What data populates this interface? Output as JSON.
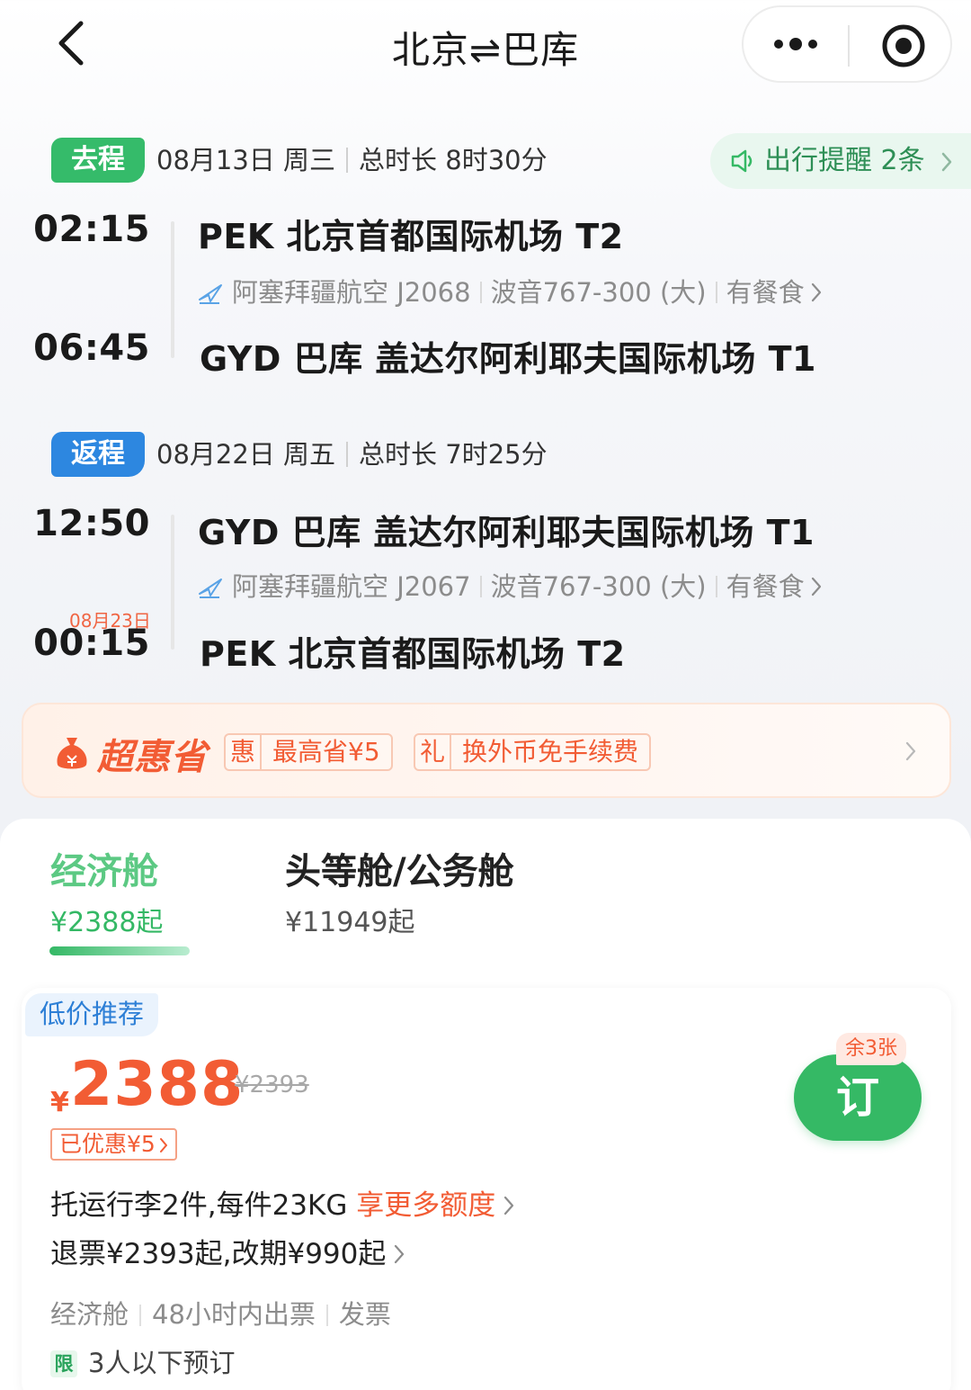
{
  "nav": {
    "title_from": "北京",
    "title_arrow": "⇌",
    "title_to": "巴库",
    "back_icon": "chevron-left-icon",
    "more_icon": "more-dots-icon",
    "target_icon": "close-target-icon"
  },
  "outbound": {
    "tag": "去程",
    "date": "08月13日 周三",
    "duration": "总时长 8时30分",
    "reminder": "出行提醒 2条",
    "dep_time": "02:15",
    "dep_airport": "PEK 北京首都国际机场 T2",
    "airline": "阿塞拜疆航空 J2068",
    "aircraft": "波音767-300 (大)",
    "meal": "有餐食",
    "arr_time": "06:45",
    "arr_airport": "GYD 巴库 盖达尔阿利耶夫国际机场 T1"
  },
  "return": {
    "tag": "返程",
    "date": "08月22日 周五",
    "duration": "总时长 7时25分",
    "dep_time": "12:50",
    "dep_airport": "GYD 巴库 盖达尔阿利耶夫国际机场 T1",
    "airline": "阿塞拜疆航空 J2067",
    "aircraft": "波音767-300 (大)",
    "meal": "有餐食",
    "arr_date": "08月23日",
    "arr_time": "00:15",
    "arr_airport": "PEK 北京首都国际机场 T2"
  },
  "promo": {
    "brand": "超惠省",
    "chip1_key": "惠",
    "chip1_val": "最高省¥5",
    "chip2_key": "礼",
    "chip2_val": "换外币免手续费"
  },
  "cabins": [
    {
      "name": "经济舱",
      "price": "¥2388起"
    },
    {
      "name": "头等舱/公务舱",
      "price": "¥11949起"
    }
  ],
  "offer": {
    "badge": "低价推荐",
    "currency": "¥",
    "price": "2388",
    "original_price": "¥2393",
    "discount": "已优惠¥5",
    "remaining": "余3张",
    "book_label": "订",
    "baggage": "托运行李2件,每件23KG",
    "baggage_more": "享更多额度",
    "refund": "退票¥2393起,改期¥990起",
    "meta_cabin": "经济舱",
    "meta_ticket": "48小时内出票",
    "meta_invoice": "发票",
    "limit_label": "限",
    "limit_text": "3人以下预订"
  },
  "colors": {
    "green": "#35b965",
    "blue": "#2d87e0",
    "orange": "#f25c34"
  }
}
